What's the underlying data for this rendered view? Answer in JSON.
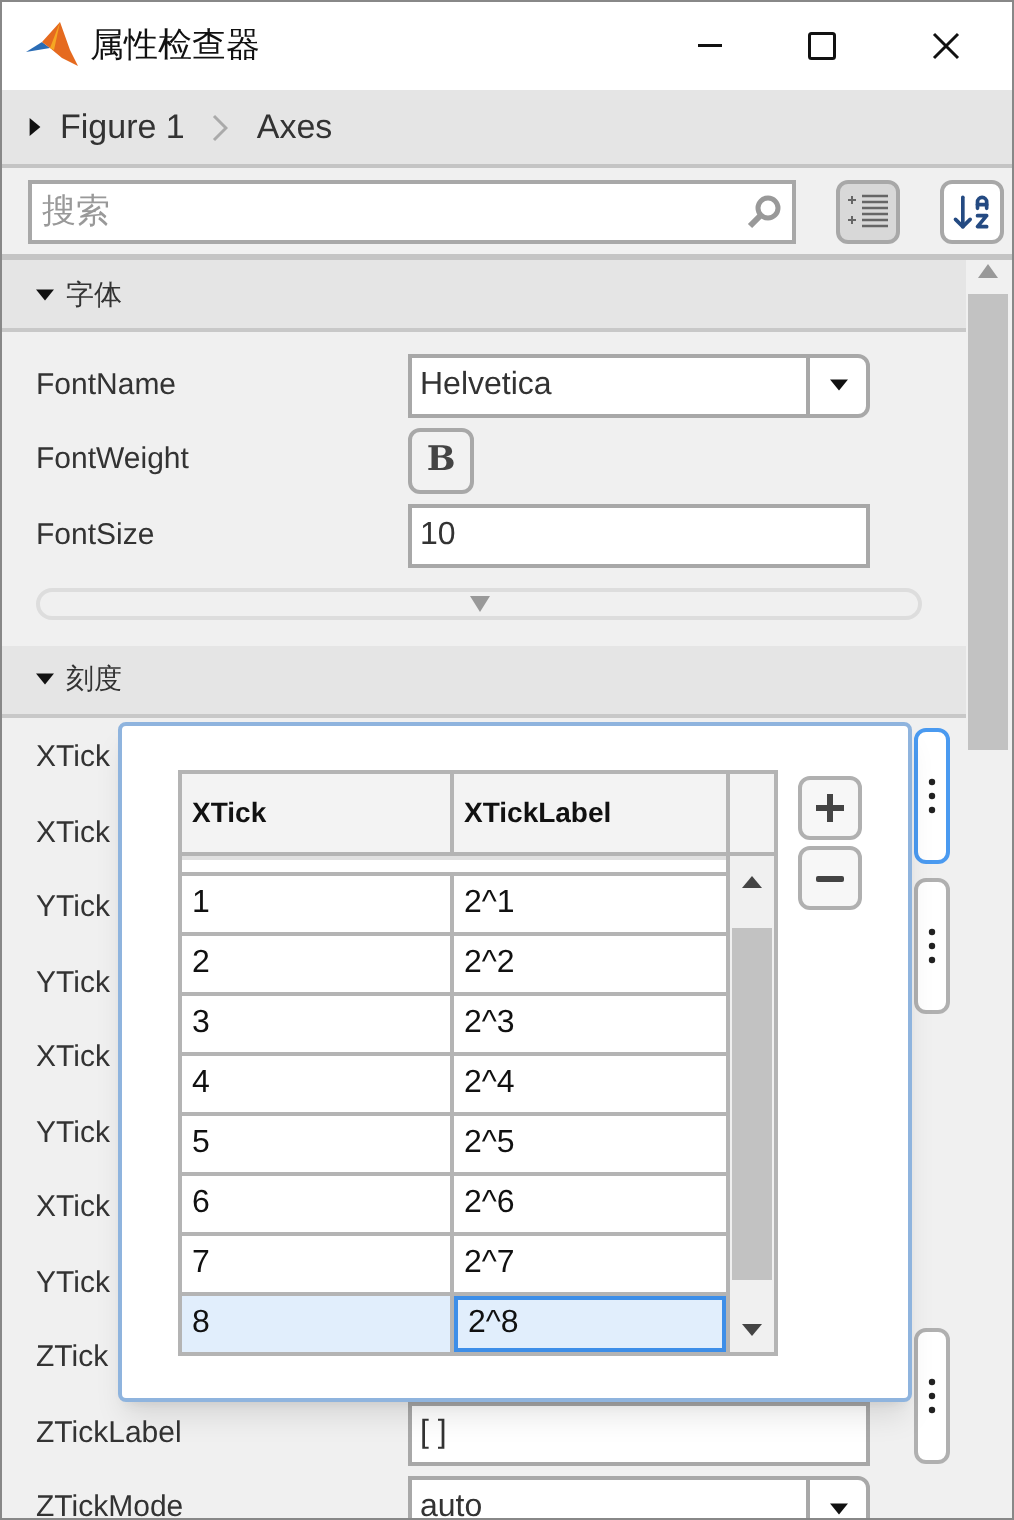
{
  "window": {
    "title": "属性检查器"
  },
  "breadcrumb": [
    {
      "label": "Figure 1",
      "kind": "expander"
    },
    {
      "label": "Axes",
      "kind": "current"
    }
  ],
  "search": {
    "placeholder": "搜索"
  },
  "view_buttons": [
    {
      "kind": "category",
      "selected": true
    },
    {
      "kind": "alpha",
      "selected": false
    }
  ],
  "font_section": {
    "title": "字体",
    "expanded": true,
    "rows": [
      {
        "label": "FontName",
        "kind": "dropdown",
        "value": "Helvetica"
      },
      {
        "label": "FontWeight",
        "kind": "toggle",
        "value": "B"
      },
      {
        "label": "FontSize",
        "kind": "text",
        "value": "10"
      }
    ]
  },
  "tick_section": {
    "title": "刻度",
    "expanded": true,
    "groups": [
      {
        "kind": "editor",
        "selected": true,
        "rows": [
          {
            "label": "XTick"
          },
          {
            "label": "XTick"
          }
        ]
      },
      {
        "kind": "editor",
        "selected": false,
        "rows": [
          {
            "label": "YTick"
          },
          {
            "label": "YTick"
          }
        ]
      },
      {
        "kind": "plain",
        "rows": [
          {
            "label": "XTick"
          },
          {
            "label": "YTick"
          },
          {
            "label": "XTick"
          },
          {
            "label": "YTick"
          }
        ]
      },
      {
        "kind": "editor",
        "selected": false,
        "rows": [
          {
            "label": "ZTick"
          },
          {
            "label": "ZTickLabel",
            "kind": "text",
            "value": "[ ]"
          }
        ]
      },
      {
        "kind": "plain",
        "rows": [
          {
            "label": "ZTickMode",
            "kind": "dropdown",
            "value": "auto"
          }
        ]
      }
    ]
  },
  "tick_editor": {
    "columns": [
      "XTick",
      "XTickLabel"
    ],
    "rows": [
      {
        "cells": [
          "1",
          "2^1"
        ],
        "selected": false
      },
      {
        "cells": [
          "2",
          "2^2"
        ],
        "selected": false
      },
      {
        "cells": [
          "3",
          "2^3"
        ],
        "selected": false
      },
      {
        "cells": [
          "4",
          "2^4"
        ],
        "selected": false
      },
      {
        "cells": [
          "5",
          "2^5"
        ],
        "selected": false
      },
      {
        "cells": [
          "6",
          "2^6"
        ],
        "selected": false
      },
      {
        "cells": [
          "7",
          "2^7"
        ],
        "selected": false
      },
      {
        "cells": [
          "8",
          "2^8"
        ],
        "selected": true
      }
    ]
  }
}
